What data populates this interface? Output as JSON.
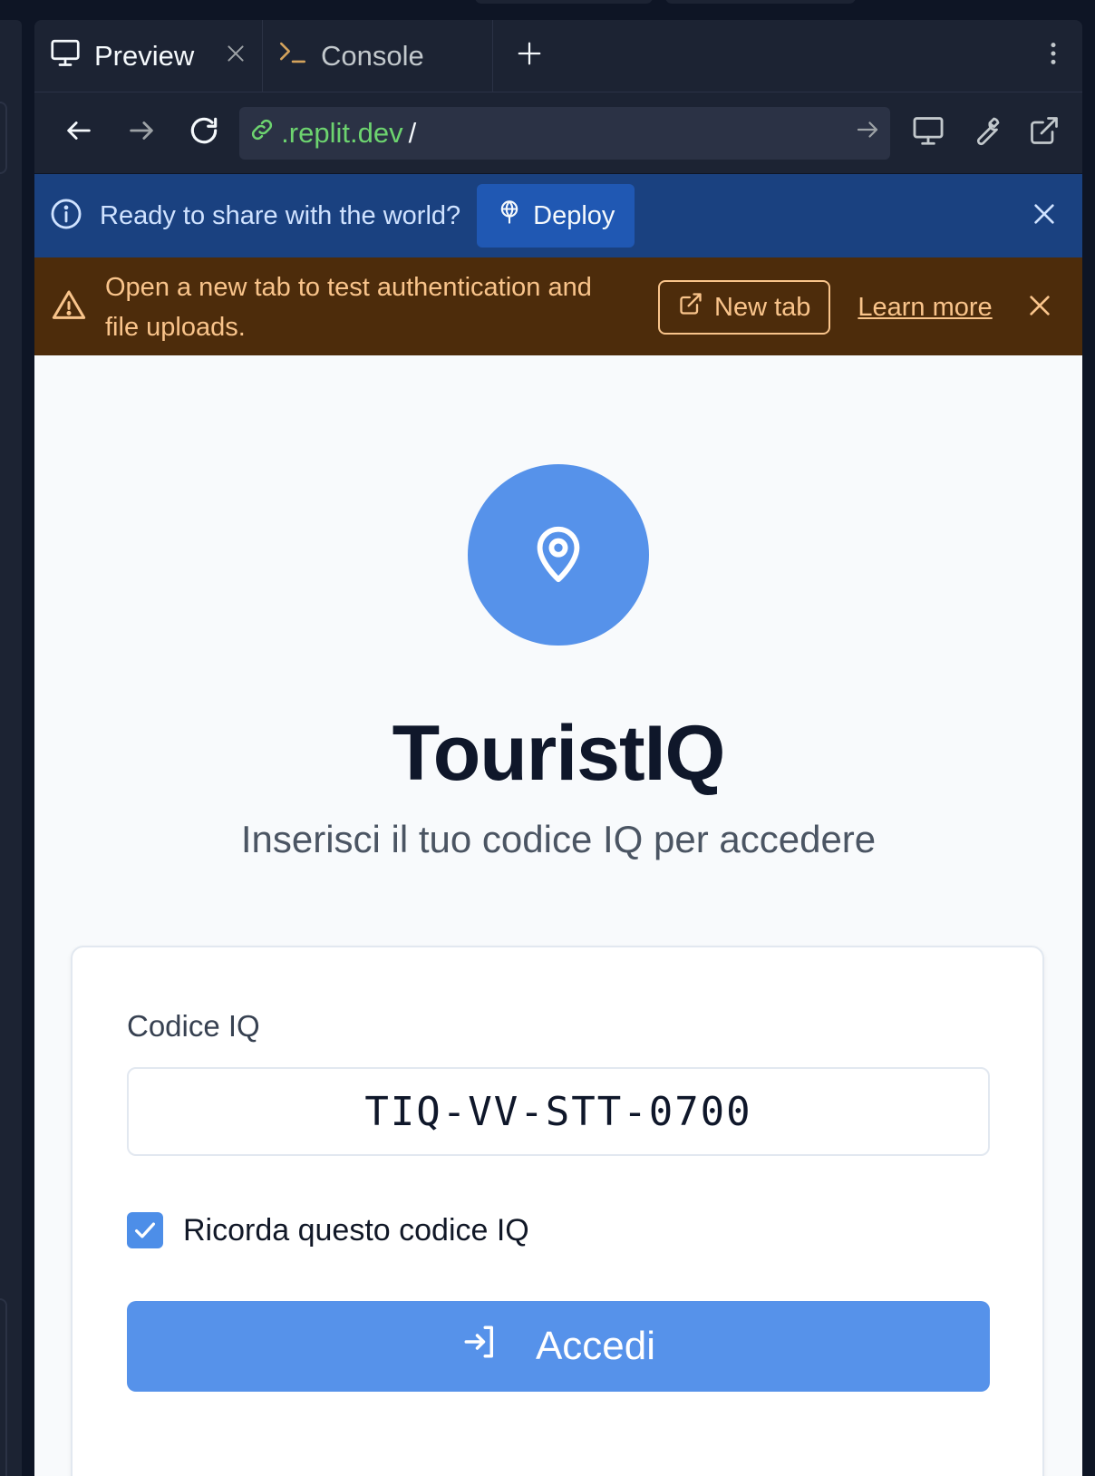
{
  "tabs": [
    {
      "label": "Preview",
      "icon": "monitor-icon",
      "active": true
    },
    {
      "label": "Console",
      "icon": "terminal-prompt-icon",
      "active": false
    }
  ],
  "urlbar": {
    "host": ".replit.dev",
    "path": "/"
  },
  "deploy_banner": {
    "message": "Ready to share with the world?",
    "button_label": "Deploy"
  },
  "warning_banner": {
    "message": "Open a new tab to test authentication and file uploads.",
    "new_tab_label": "New tab",
    "learn_more_label": "Learn more"
  },
  "app": {
    "title": "TouristIQ",
    "subtitle": "Inserisci il tuo codice IQ per accedere",
    "field_label": "Codice IQ",
    "code_value": "TIQ-VV-STT-0700",
    "remember_label": "Ricorda questo codice IQ",
    "remember_checked": true,
    "submit_label": "Accedi"
  },
  "colors": {
    "ide_bg": "#1c2333",
    "deploy_bg": "#1a4180",
    "warning_bg": "#4d2c0b",
    "warning_text": "#f9c48b",
    "brand_blue": "#5692ea",
    "url_green": "#6dd46f"
  }
}
